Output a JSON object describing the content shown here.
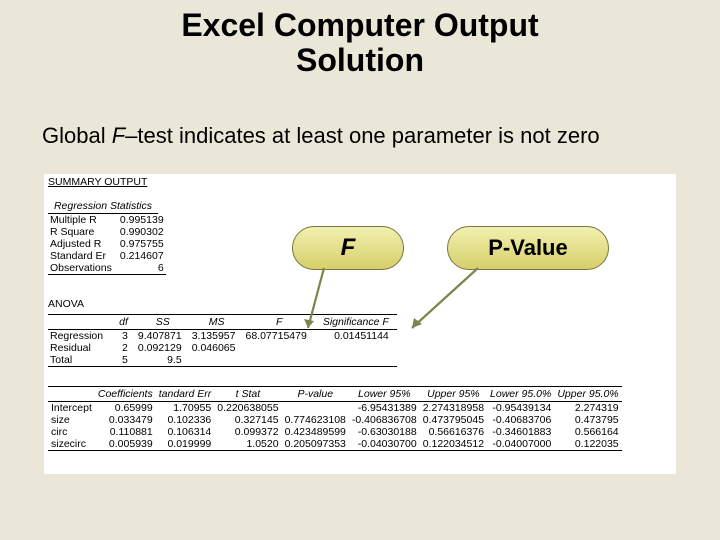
{
  "title_line1": "Excel Computer Output",
  "title_line2": "Solution",
  "subtitle_a": "Global ",
  "subtitle_f": "F",
  "subtitle_b": "–test indicates at least one parameter is not zero",
  "pill_f": "F",
  "pill_p": "P-Value",
  "excel": {
    "summary_caption": "SUMMARY OUTPUT",
    "reg_stats_title": "Regression Statistics",
    "reg_stats": [
      {
        "label": "Multiple R",
        "value": "0.995139"
      },
      {
        "label": "R Square",
        "value": "0.990302"
      },
      {
        "label": "Adjusted R",
        "value": "0.975755"
      },
      {
        "label": "Standard Er",
        "value": "0.214607"
      },
      {
        "label": "Observations",
        "value": "6"
      }
    ],
    "anova_label": "ANOVA",
    "anova_headers": [
      "",
      "df",
      "SS",
      "MS",
      "F",
      "Significance F"
    ],
    "anova_rows": [
      {
        "lbl": "Regression",
        "df": "3",
        "ss": "9.407871",
        "ms": "3.135957",
        "f": "68.07715479",
        "sig": "0.01451144"
      },
      {
        "lbl": "Residual",
        "df": "2",
        "ss": "0.092129",
        "ms": "0.046065",
        "f": "",
        "sig": ""
      },
      {
        "lbl": "Total",
        "df": "5",
        "ss": "9.5",
        "ms": "",
        "f": "",
        "sig": ""
      }
    ],
    "coef_headers": [
      "",
      "Coefficients",
      "tandard Err",
      "t Stat",
      "P-value",
      "Lower 95%",
      "Upper 95%",
      "Lower 95.0%",
      "Upper 95.0%"
    ],
    "coef_rows": [
      {
        "lbl": "Intercept",
        "c": "0.65999",
        "se": "1.70955",
        "t": "0.220638055",
        "p": "",
        "lo": "-6.95431389",
        "hi": "2.274318958",
        "lo2": "-0.95439134",
        "hi2": "2.274319"
      },
      {
        "lbl": "size",
        "c": "0.033479",
        "se": "0.102336",
        "t": "0.327145",
        "p": "0.774623108",
        "lo": "-0.406836708",
        "hi": "0.473795045",
        "lo2": "-0.40683706",
        "hi2": "0.473795"
      },
      {
        "lbl": "circ",
        "c": "0.110881",
        "se": "0.106314",
        "t": "0.099372",
        "p": "0.423489599",
        "lo": "-0.63030188",
        "hi": "0.56616376",
        "lo2": "-0.34601883",
        "hi2": "0.566164"
      },
      {
        "lbl": "sizecirc",
        "c": "0.005939",
        "se": "0.019999",
        "t": "1.0520",
        "p": "0.205097353",
        "lo": "-0.04030700",
        "hi": "0.122034512",
        "lo2": "-0.04007000",
        "hi2": "0.122035"
      }
    ]
  }
}
